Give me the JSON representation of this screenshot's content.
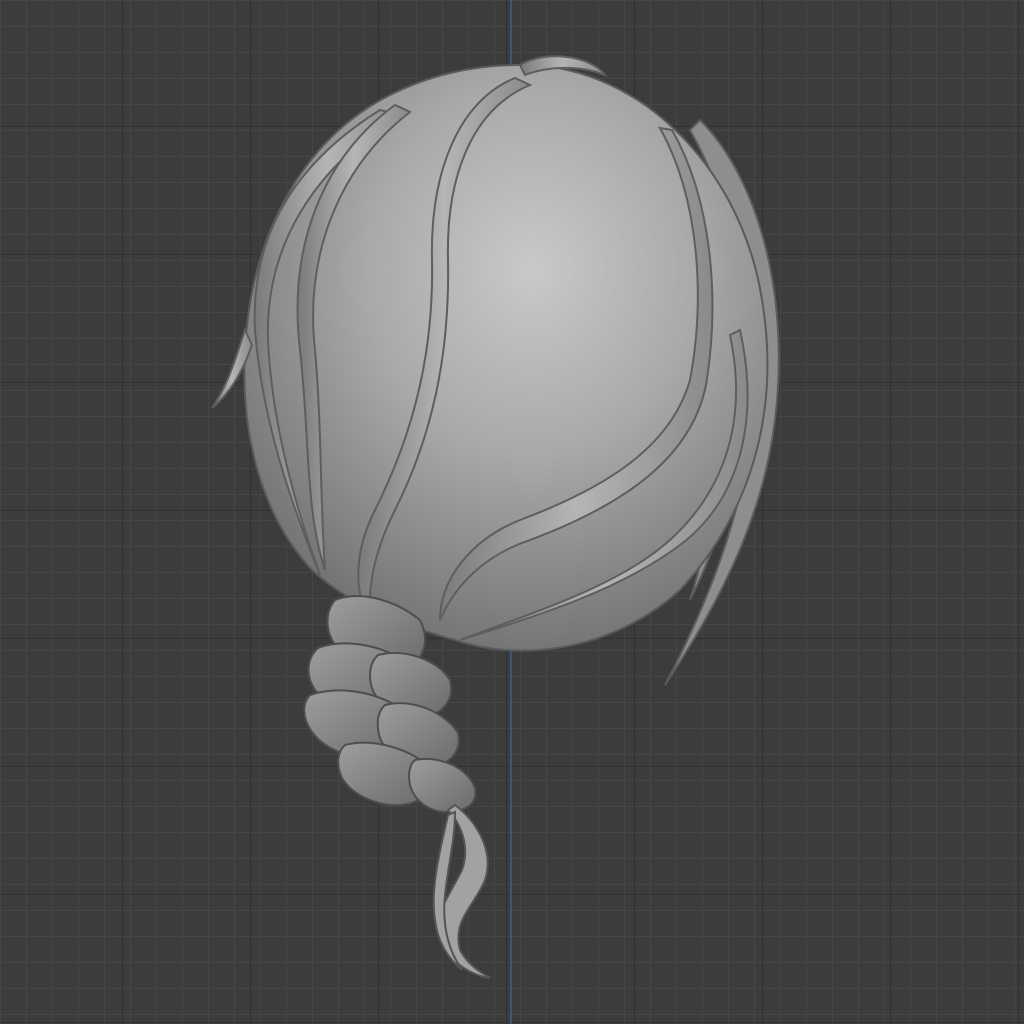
{
  "viewport": {
    "object": "hair-mesh",
    "colors": {
      "background": "#3c3c3c",
      "grid_minor": "#464646",
      "grid_major": "#313131",
      "axis_z": "#3d5a80",
      "mesh_base": "#8a8a8a",
      "mesh_highlight": "#c4c4c4",
      "mesh_shadow": "#5a5a5a"
    }
  }
}
